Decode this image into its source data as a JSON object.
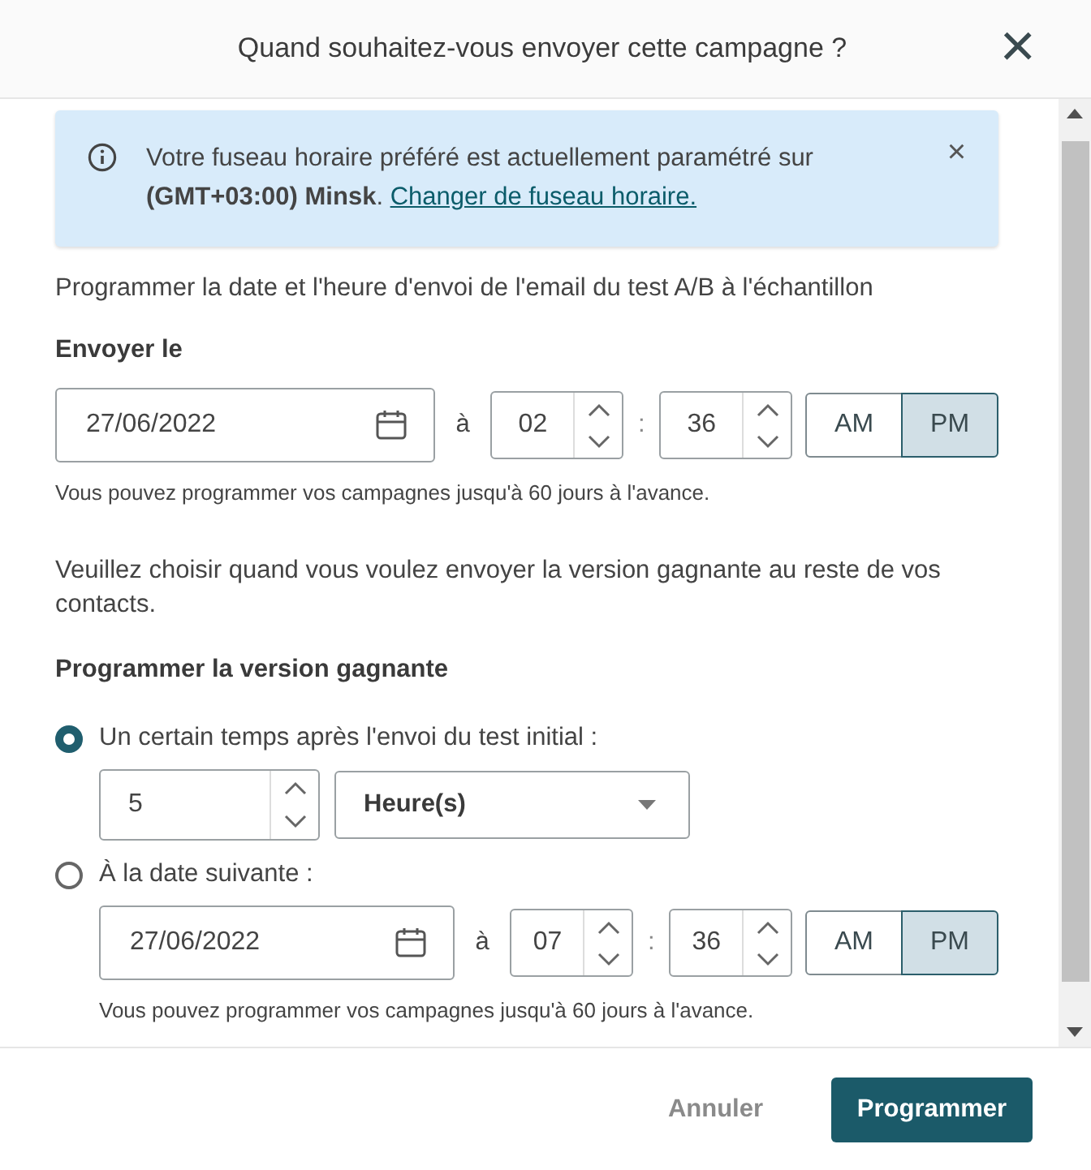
{
  "dialog": {
    "title": "Quand souhaitez-vous envoyer cette campagne ?",
    "close": "×"
  },
  "alert": {
    "text": "Votre fuseau horaire préféré est actuellement paramétré sur **(GMT+03:00) Minsk**.",
    "link": "Changer de fuseau horaire.",
    "close": "×"
  },
  "intro": "Programmer la date et l'heure d'envoi de l'email du test A/B à l'échantillon",
  "send": {
    "label": "Envoyer le",
    "date": "27/06/2022",
    "at": "à",
    "hour": "02",
    "colon": ":",
    "minute": "36",
    "ampm": [
      {
        "label": "AM",
        "selected": false
      },
      {
        "label": "PM",
        "selected": true
      }
    ],
    "hint": "Vous pouvez programmer vos campagnes jusqu'à 60 jours à l'avance."
  },
  "winner_prompt": "Veuillez choisir quand vous voulez envoyer la version gagnante au reste de vos contacts.",
  "winner_label": "Programmer la version gagnante",
  "options": [
    {
      "kind": "delay",
      "label": "Un certain temps après l'envoi du test initial :",
      "selected": true,
      "amount": "5",
      "unit": "Heure(s)"
    },
    {
      "kind": "date",
      "label": "À la date suivante :",
      "selected": false,
      "date": "27/06/2022",
      "at": "à",
      "hour": "07",
      "colon": ":",
      "minute": "36",
      "ampm": [
        {
          "label": "AM",
          "selected": false
        },
        {
          "label": "PM",
          "selected": true
        }
      ],
      "hint": "Vous pouvez programmer vos campagnes jusqu'à 60 jours à l'avance."
    }
  ],
  "footer": {
    "cancel": "Annuler",
    "submit": "Programmer"
  }
}
